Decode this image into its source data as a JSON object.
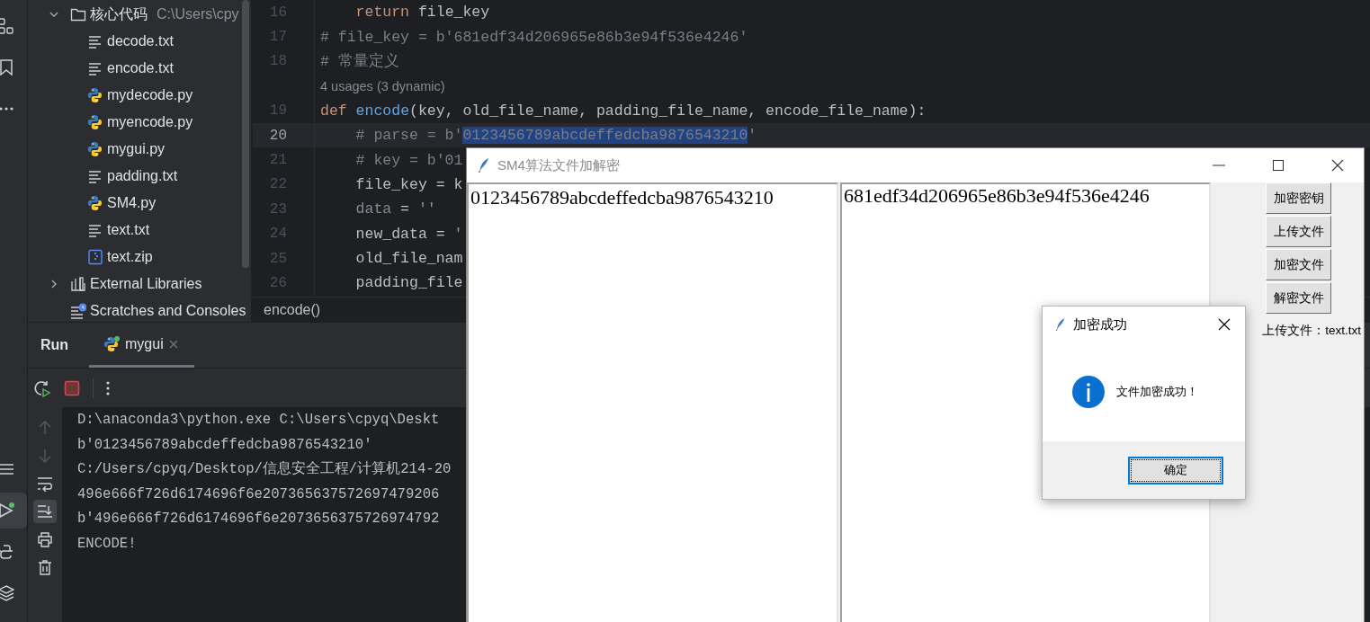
{
  "activity_bar": {
    "top": [
      {
        "selected": false
      },
      {
        "selected": false
      },
      {
        "selected": false
      }
    ],
    "bottom": [
      {
        "selected": false
      },
      {
        "selected": true
      },
      {
        "selected": false
      },
      {
        "selected": false
      }
    ]
  },
  "project_tree": [
    {
      "label": "核心代码",
      "hint": "C:\\Users\\cpy",
      "kind": "folder",
      "expanded": true,
      "children": [
        {
          "label": "decode.txt",
          "kind": "text"
        },
        {
          "label": "encode.txt",
          "kind": "text"
        },
        {
          "label": "mydecode.py",
          "kind": "python"
        },
        {
          "label": "myencode.py",
          "kind": "python"
        },
        {
          "label": "mygui.py",
          "kind": "python"
        },
        {
          "label": "padding.txt",
          "kind": "text"
        },
        {
          "label": "SM4.py",
          "kind": "python"
        },
        {
          "label": "text.txt",
          "kind": "text"
        },
        {
          "label": "text.zip",
          "kind": "archive"
        }
      ]
    },
    {
      "label": "External Libraries",
      "kind": "library",
      "expanded": false
    },
    {
      "label": "Scratches and Consoles",
      "kind": "scratches"
    }
  ],
  "editor": {
    "lines": [
      {
        "number": "16",
        "current": false,
        "tokens": [
          {
            "text": "    return",
            "kind": "keyword"
          },
          {
            "text": " file_key",
            "kind": "plain"
          }
        ]
      },
      {
        "number": "17",
        "current": false,
        "tokens": [
          {
            "text": "# file_key = b'681edf34d206965e86b3e94f536e4246'",
            "kind": "comment"
          }
        ]
      },
      {
        "number": "18",
        "current": false,
        "tokens": [
          {
            "text": "# 常量定义",
            "kind": "comment"
          }
        ]
      },
      {
        "kind": "hint",
        "text": "4 usages (3 dynamic)"
      },
      {
        "number": "19",
        "current": false,
        "tokens": [
          {
            "text": "def",
            "kind": "keyword"
          },
          {
            "text": " encode",
            "kind": "function"
          },
          {
            "text": "(key, old_file_name, padding_file_name, encode_file_name):",
            "kind": "plain"
          }
        ]
      },
      {
        "number": "20",
        "current": true,
        "tokens": [
          {
            "text": "    # parse = b'",
            "kind": "comment"
          },
          {
            "text": "0123456789abcdeffedcba9876543210",
            "kind": "selection"
          },
          {
            "text": "'",
            "kind": "comment"
          }
        ]
      },
      {
        "number": "21",
        "current": false,
        "tokens": [
          {
            "text": "    # key = b'01",
            "kind": "comment"
          }
        ]
      },
      {
        "number": "22",
        "current": false,
        "tokens": [
          {
            "text": "    file_key = k",
            "kind": "plain"
          }
        ]
      },
      {
        "number": "23",
        "current": false,
        "tokens": [
          {
            "text": "    data",
            "kind": "unused"
          },
          {
            "text": " = ",
            "kind": "plain"
          },
          {
            "text": "''",
            "kind": "string"
          }
        ]
      },
      {
        "number": "24",
        "current": false,
        "tokens": [
          {
            "text": "    new_data = ",
            "kind": "plain"
          },
          {
            "text": "'",
            "kind": "string"
          }
        ]
      },
      {
        "number": "25",
        "current": false,
        "tokens": [
          {
            "text": "    old_file_nam",
            "kind": "plain"
          }
        ]
      },
      {
        "number": "26",
        "current": false,
        "tokens": [
          {
            "text": "    padding_file",
            "kind": "plain"
          }
        ]
      }
    ],
    "breadcrumb": "encode()"
  },
  "run_panel": {
    "title": "Run",
    "tabs": [
      {
        "label": "mygui",
        "selected": true
      }
    ],
    "console": [
      "D:\\anaconda3\\python.exe C:\\Users\\cpyq\\Deskt",
      "b'0123456789abcdeffedcba9876543210'",
      "C:/Users/cpyq/Desktop/信息安全工程/计算机214-20",
      "496e666f726d6174696f6e207365637572697479206",
      "b'496e666f726d6174696f6e2073656375726974792",
      "ENCODE!"
    ]
  },
  "app_window": {
    "title": "SM4算法文件加解密",
    "text_areas": [
      "0123456789abcdeffedcba9876543210",
      "681edf34d206965e86b3e94f536e4246"
    ],
    "buttons": [
      "加密密钥",
      "上传文件",
      "加密文件",
      "解密文件"
    ],
    "status": "上传文件：text.txt"
  },
  "dialog": {
    "title": "加密成功",
    "message": "文件加密成功！",
    "button": "确定"
  }
}
